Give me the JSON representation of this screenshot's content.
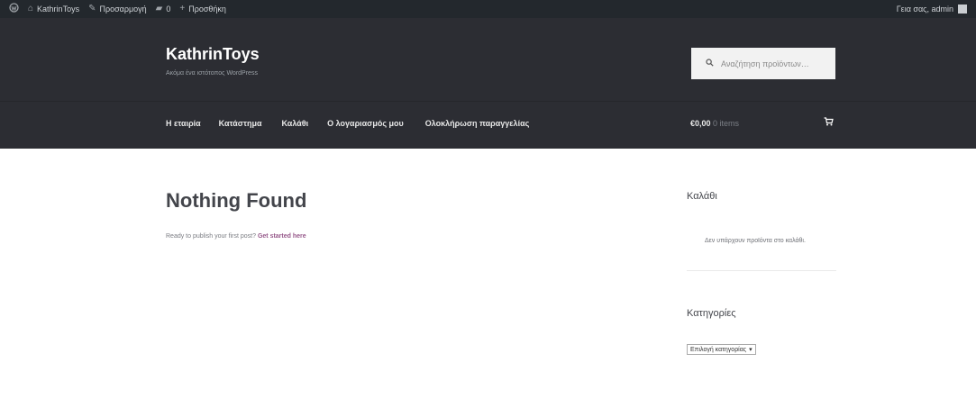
{
  "adminbar": {
    "site_name": "KathrinToys",
    "customize": "Προσαρμογή",
    "comments_count": "0",
    "new": "Προσθήκη",
    "greeting": "Γεια σας, admin",
    "icons": [
      "wordpress-icon",
      "home-icon",
      "brush-icon",
      "comment-icon",
      "plus-icon"
    ]
  },
  "header": {
    "title": "KathrinToys",
    "description": "Ακόμα ένα ιστότοπος WordPress",
    "search_placeholder": "Αναζήτηση προϊόντων…"
  },
  "nav": {
    "items": [
      "Η εταιρία",
      "Κατάστημα",
      "Καλάθι",
      "Ο λογαριασμός μου",
      "Ολοκλήρωση παραγγελίας"
    ]
  },
  "cart": {
    "total": "€0,00",
    "items": "0 items"
  },
  "main": {
    "heading": "Nothing Found",
    "text": "Ready to publish your first post? ",
    "link": "Get started here"
  },
  "sidebar": {
    "cart_heading": "Καλάθι",
    "cart_empty": "Δεν υπάρχουν προϊόντα στο καλάθι.",
    "categories_heading": "Κατηγορίες",
    "categories_select": "Επιλογή κατηγορίας"
  },
  "colors": {
    "header_bg": "#2c2d33",
    "adminbar_bg": "#23282d",
    "accent_link": "#96588a"
  }
}
